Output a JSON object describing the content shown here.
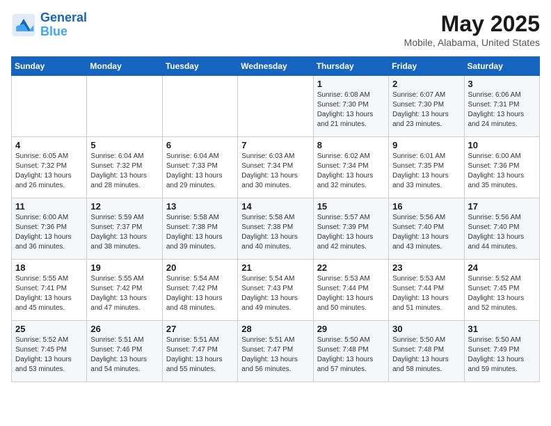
{
  "header": {
    "logo_line1": "General",
    "logo_line2": "Blue",
    "title": "May 2025",
    "subtitle": "Mobile, Alabama, United States"
  },
  "days_of_week": [
    "Sunday",
    "Monday",
    "Tuesday",
    "Wednesday",
    "Thursday",
    "Friday",
    "Saturday"
  ],
  "weeks": [
    [
      {
        "day": "",
        "info": ""
      },
      {
        "day": "",
        "info": ""
      },
      {
        "day": "",
        "info": ""
      },
      {
        "day": "",
        "info": ""
      },
      {
        "day": "1",
        "info": "Sunrise: 6:08 AM\nSunset: 7:30 PM\nDaylight: 13 hours\nand 21 minutes."
      },
      {
        "day": "2",
        "info": "Sunrise: 6:07 AM\nSunset: 7:30 PM\nDaylight: 13 hours\nand 23 minutes."
      },
      {
        "day": "3",
        "info": "Sunrise: 6:06 AM\nSunset: 7:31 PM\nDaylight: 13 hours\nand 24 minutes."
      }
    ],
    [
      {
        "day": "4",
        "info": "Sunrise: 6:05 AM\nSunset: 7:32 PM\nDaylight: 13 hours\nand 26 minutes."
      },
      {
        "day": "5",
        "info": "Sunrise: 6:04 AM\nSunset: 7:32 PM\nDaylight: 13 hours\nand 28 minutes."
      },
      {
        "day": "6",
        "info": "Sunrise: 6:04 AM\nSunset: 7:33 PM\nDaylight: 13 hours\nand 29 minutes."
      },
      {
        "day": "7",
        "info": "Sunrise: 6:03 AM\nSunset: 7:34 PM\nDaylight: 13 hours\nand 30 minutes."
      },
      {
        "day": "8",
        "info": "Sunrise: 6:02 AM\nSunset: 7:34 PM\nDaylight: 13 hours\nand 32 minutes."
      },
      {
        "day": "9",
        "info": "Sunrise: 6:01 AM\nSunset: 7:35 PM\nDaylight: 13 hours\nand 33 minutes."
      },
      {
        "day": "10",
        "info": "Sunrise: 6:00 AM\nSunset: 7:36 PM\nDaylight: 13 hours\nand 35 minutes."
      }
    ],
    [
      {
        "day": "11",
        "info": "Sunrise: 6:00 AM\nSunset: 7:36 PM\nDaylight: 13 hours\nand 36 minutes."
      },
      {
        "day": "12",
        "info": "Sunrise: 5:59 AM\nSunset: 7:37 PM\nDaylight: 13 hours\nand 38 minutes."
      },
      {
        "day": "13",
        "info": "Sunrise: 5:58 AM\nSunset: 7:38 PM\nDaylight: 13 hours\nand 39 minutes."
      },
      {
        "day": "14",
        "info": "Sunrise: 5:58 AM\nSunset: 7:38 PM\nDaylight: 13 hours\nand 40 minutes."
      },
      {
        "day": "15",
        "info": "Sunrise: 5:57 AM\nSunset: 7:39 PM\nDaylight: 13 hours\nand 42 minutes."
      },
      {
        "day": "16",
        "info": "Sunrise: 5:56 AM\nSunset: 7:40 PM\nDaylight: 13 hours\nand 43 minutes."
      },
      {
        "day": "17",
        "info": "Sunrise: 5:56 AM\nSunset: 7:40 PM\nDaylight: 13 hours\nand 44 minutes."
      }
    ],
    [
      {
        "day": "18",
        "info": "Sunrise: 5:55 AM\nSunset: 7:41 PM\nDaylight: 13 hours\nand 45 minutes."
      },
      {
        "day": "19",
        "info": "Sunrise: 5:55 AM\nSunset: 7:42 PM\nDaylight: 13 hours\nand 47 minutes."
      },
      {
        "day": "20",
        "info": "Sunrise: 5:54 AM\nSunset: 7:42 PM\nDaylight: 13 hours\nand 48 minutes."
      },
      {
        "day": "21",
        "info": "Sunrise: 5:54 AM\nSunset: 7:43 PM\nDaylight: 13 hours\nand 49 minutes."
      },
      {
        "day": "22",
        "info": "Sunrise: 5:53 AM\nSunset: 7:44 PM\nDaylight: 13 hours\nand 50 minutes."
      },
      {
        "day": "23",
        "info": "Sunrise: 5:53 AM\nSunset: 7:44 PM\nDaylight: 13 hours\nand 51 minutes."
      },
      {
        "day": "24",
        "info": "Sunrise: 5:52 AM\nSunset: 7:45 PM\nDaylight: 13 hours\nand 52 minutes."
      }
    ],
    [
      {
        "day": "25",
        "info": "Sunrise: 5:52 AM\nSunset: 7:45 PM\nDaylight: 13 hours\nand 53 minutes."
      },
      {
        "day": "26",
        "info": "Sunrise: 5:51 AM\nSunset: 7:46 PM\nDaylight: 13 hours\nand 54 minutes."
      },
      {
        "day": "27",
        "info": "Sunrise: 5:51 AM\nSunset: 7:47 PM\nDaylight: 13 hours\nand 55 minutes."
      },
      {
        "day": "28",
        "info": "Sunrise: 5:51 AM\nSunset: 7:47 PM\nDaylight: 13 hours\nand 56 minutes."
      },
      {
        "day": "29",
        "info": "Sunrise: 5:50 AM\nSunset: 7:48 PM\nDaylight: 13 hours\nand 57 minutes."
      },
      {
        "day": "30",
        "info": "Sunrise: 5:50 AM\nSunset: 7:48 PM\nDaylight: 13 hours\nand 58 minutes."
      },
      {
        "day": "31",
        "info": "Sunrise: 5:50 AM\nSunset: 7:49 PM\nDaylight: 13 hours\nand 59 minutes."
      }
    ]
  ]
}
